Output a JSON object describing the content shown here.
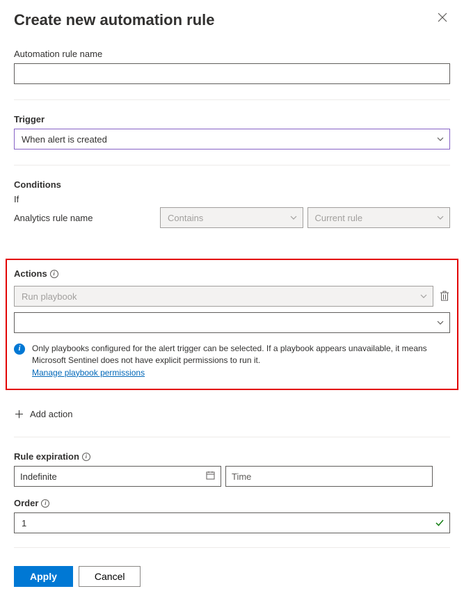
{
  "header": {
    "title": "Create new automation rule"
  },
  "rule_name": {
    "label": "Automation rule name",
    "value": ""
  },
  "trigger": {
    "label": "Trigger",
    "value": "When alert is created"
  },
  "conditions": {
    "label": "Conditions",
    "if_label": "If",
    "field_label": "Analytics rule name",
    "operator": "Contains",
    "value": "Current rule"
  },
  "actions": {
    "label": "Actions",
    "playbook_select": "Run playbook",
    "secondary_select": "",
    "info_text": "Only playbooks configured for the alert trigger can be selected. If a playbook appears unavailable, it means Microsoft Sentinel does not have explicit permissions to run it.",
    "permissions_link": "Manage playbook permissions",
    "add_action": "Add action"
  },
  "expiration": {
    "label": "Rule expiration",
    "date": "Indefinite",
    "time_placeholder": "Time"
  },
  "order": {
    "label": "Order",
    "value": "1"
  },
  "footer": {
    "apply": "Apply",
    "cancel": "Cancel"
  }
}
